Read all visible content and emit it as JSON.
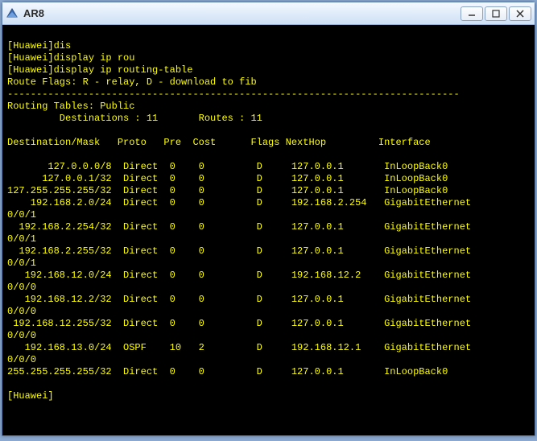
{
  "window": {
    "title": "AR8"
  },
  "terminal": {
    "prompt": "[Huawei]",
    "cmd1": "dis",
    "cmd2": "display ip rou",
    "cmd3": "display ip routing-table",
    "flags_legend": "Route Flags: R - relay, D - download to fib",
    "dashes": "------------------------------------------------------------------------------",
    "table_header": "Routing Tables: Public",
    "dest_label": "Destinations :",
    "dest_count": "11",
    "routes_label": "Routes :",
    "routes_count": "11",
    "col": {
      "dest": "Destination/Mask",
      "proto": "Proto",
      "pre": "Pre",
      "cost": "Cost",
      "flags": "Flags",
      "nexthop": "NextHop",
      "iface": "Interface"
    },
    "rows": [
      {
        "dest": "127.0.0.0/8",
        "proto": "Direct",
        "pre": "0",
        "cost": "0",
        "flags": "D",
        "nexthop": "127.0.0.1",
        "iface": "InLoopBack0",
        "wrap": ""
      },
      {
        "dest": "127.0.0.1/32",
        "proto": "Direct",
        "pre": "0",
        "cost": "0",
        "flags": "D",
        "nexthop": "127.0.0.1",
        "iface": "InLoopBack0",
        "wrap": ""
      },
      {
        "dest": "127.255.255.255/32",
        "proto": "Direct",
        "pre": "0",
        "cost": "0",
        "flags": "D",
        "nexthop": "127.0.0.1",
        "iface": "InLoopBack0",
        "wrap": ""
      },
      {
        "dest": "192.168.2.0/24",
        "proto": "Direct",
        "pre": "0",
        "cost": "0",
        "flags": "D",
        "nexthop": "192.168.2.254",
        "iface": "GigabitEthernet",
        "wrap": "0/0/1"
      },
      {
        "dest": "192.168.2.254/32",
        "proto": "Direct",
        "pre": "0",
        "cost": "0",
        "flags": "D",
        "nexthop": "127.0.0.1",
        "iface": "GigabitEthernet",
        "wrap": "0/0/1"
      },
      {
        "dest": "192.168.2.255/32",
        "proto": "Direct",
        "pre": "0",
        "cost": "0",
        "flags": "D",
        "nexthop": "127.0.0.1",
        "iface": "GigabitEthernet",
        "wrap": "0/0/1"
      },
      {
        "dest": "192.168.12.0/24",
        "proto": "Direct",
        "pre": "0",
        "cost": "0",
        "flags": "D",
        "nexthop": "192.168.12.2",
        "iface": "GigabitEthernet",
        "wrap": "0/0/0"
      },
      {
        "dest": "192.168.12.2/32",
        "proto": "Direct",
        "pre": "0",
        "cost": "0",
        "flags": "D",
        "nexthop": "127.0.0.1",
        "iface": "GigabitEthernet",
        "wrap": "0/0/0"
      },
      {
        "dest": "192.168.12.255/32",
        "proto": "Direct",
        "pre": "0",
        "cost": "0",
        "flags": "D",
        "nexthop": "127.0.0.1",
        "iface": "GigabitEthernet",
        "wrap": "0/0/0"
      },
      {
        "dest": "192.168.13.0/24",
        "proto": "OSPF",
        "pre": "10",
        "cost": "2",
        "flags": "D",
        "nexthop": "192.168.12.1",
        "iface": "GigabitEthernet",
        "wrap": "0/0/0"
      },
      {
        "dest": "255.255.255.255/32",
        "proto": "Direct",
        "pre": "0",
        "cost": "0",
        "flags": "D",
        "nexthop": "127.0.0.1",
        "iface": "InLoopBack0",
        "wrap": ""
      }
    ]
  }
}
